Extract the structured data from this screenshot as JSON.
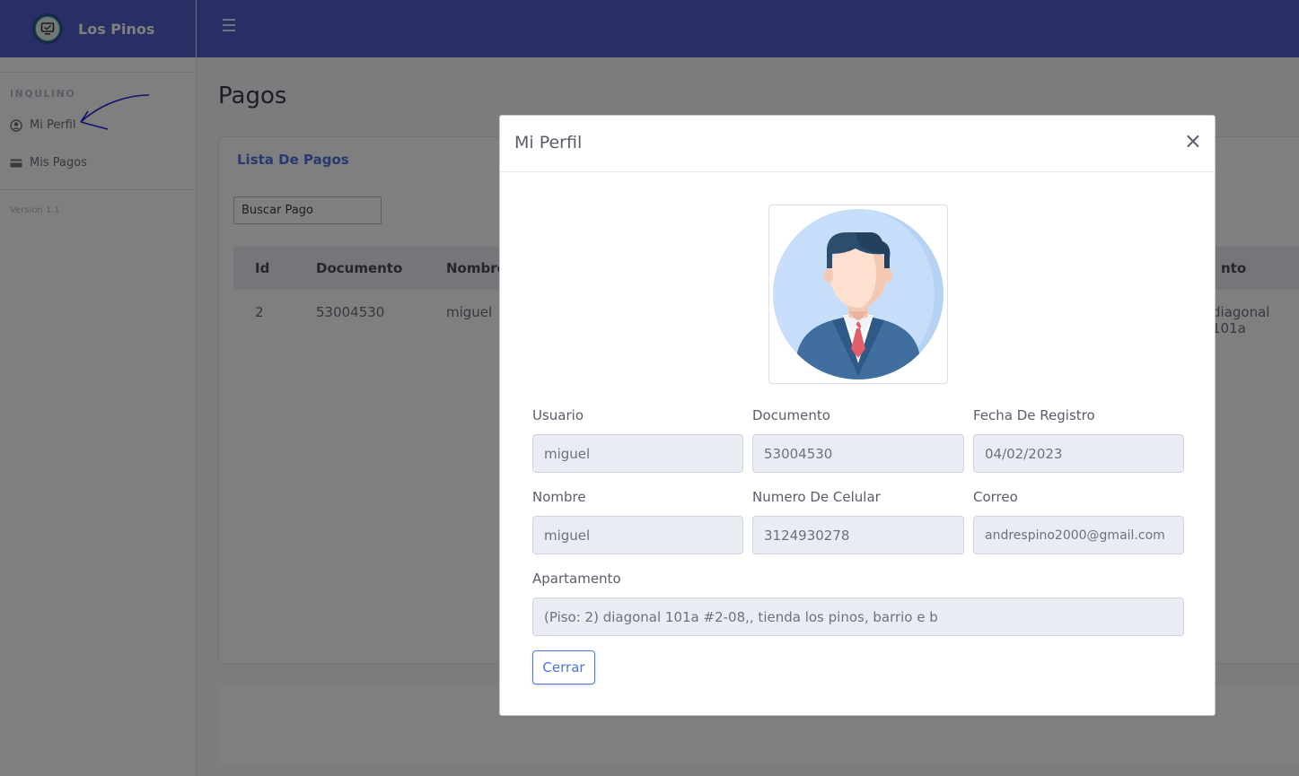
{
  "brand": {
    "name": "Los Pinos"
  },
  "sidebar": {
    "heading": "INQULINO",
    "items": [
      {
        "label": "Mi Perfil",
        "icon": "user-circle-icon"
      },
      {
        "label": "Mis Pagos",
        "icon": "credit-card-icon"
      }
    ],
    "version": "Version 1.1"
  },
  "page": {
    "title": "Pagos"
  },
  "card": {
    "title": "Lista De Pagos",
    "search_value": "Buscar Pago",
    "columns": [
      "Id",
      "Documento",
      "Nombre",
      "nto"
    ],
    "rows": [
      {
        "id": "2",
        "documento": "53004530",
        "nombre": "miguel",
        "apartamento": "diagonal 101a"
      }
    ]
  },
  "modal": {
    "title": "Mi Perfil",
    "close_symbol": "×",
    "fields": {
      "usuario": {
        "label": "Usuario",
        "value": "miguel"
      },
      "documento": {
        "label": "Documento",
        "value": "53004530"
      },
      "fecha": {
        "label": "Fecha De Registro",
        "value": "04/02/2023"
      },
      "nombre": {
        "label": "Nombre",
        "value": "miguel"
      },
      "celular": {
        "label": "Numero De Celular",
        "value": "3124930278"
      },
      "correo": {
        "label": "Correo",
        "value": "andrespino2000@gmail.com"
      },
      "apartamento": {
        "label": "Apartamento",
        "value": "(Piso: 2) diagonal 101a #2-08,, tienda los pinos, barrio e b"
      }
    },
    "button_label": "Cerrar"
  },
  "colors": {
    "brand": "#4e5fc9",
    "primary": "#4e73df",
    "input_bg": "#eaecf4"
  }
}
